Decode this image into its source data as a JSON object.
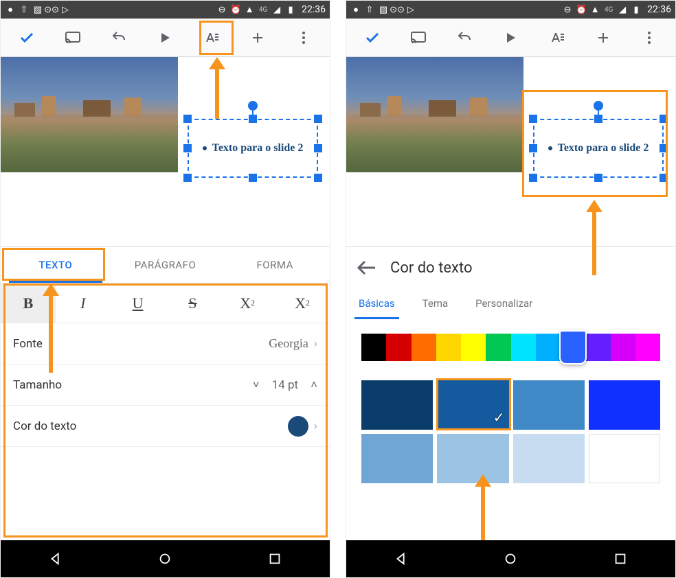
{
  "status": {
    "time": "22:36",
    "network": "4G"
  },
  "slide": {
    "textbox_text": "Texto para o slide 2"
  },
  "left": {
    "tabs": {
      "texto": "TEXTO",
      "paragrafo": "PARÁGRAFO",
      "forma": "FORMA"
    },
    "style": {
      "bold": "B",
      "italic": "I",
      "underline": "U",
      "strike": "S",
      "sup_base": "X",
      "sup": "2",
      "sub_base": "X",
      "sub": "2"
    },
    "rows": {
      "fonte_label": "Fonte",
      "fonte_value": "Georgia",
      "tamanho_label": "Tamanho",
      "tamanho_value": "14 pt",
      "cor_label": "Cor do texto"
    }
  },
  "right": {
    "title": "Cor do texto",
    "tabs": {
      "basicas": "Básicas",
      "tema": "Tema",
      "personalizar": "Personalizar"
    },
    "hues": [
      "#000000",
      "#d50000",
      "#ff6d00",
      "#ffd600",
      "#ffff00",
      "#00c853",
      "#00e5ff",
      "#00b0ff",
      "#2962ff",
      "#651fff",
      "#d500f9",
      "#ff00ff"
    ],
    "hue_selected_index": 8,
    "shades": [
      [
        "#0b3d6b",
        "#135a9e",
        "#3f89c7",
        "#1030ff"
      ],
      [
        "#6fa6d6",
        "#9cc3e3",
        "#c7dcf0",
        "#ffffff"
      ]
    ],
    "shade_selected_row": 0,
    "shade_selected_col": 1,
    "selected_color": "#135a9e"
  },
  "icons": {
    "check": "check",
    "cast": "cast",
    "undo": "undo",
    "play": "play",
    "text_format": "text-format",
    "plus": "plus",
    "more": "more-vertical",
    "back": "back",
    "home": "home",
    "recent": "recent",
    "arrow_left": "arrow-left",
    "chevron_right": "›",
    "chevron_up": "˄",
    "chevron_down": "˅",
    "checkmark": "✓"
  }
}
